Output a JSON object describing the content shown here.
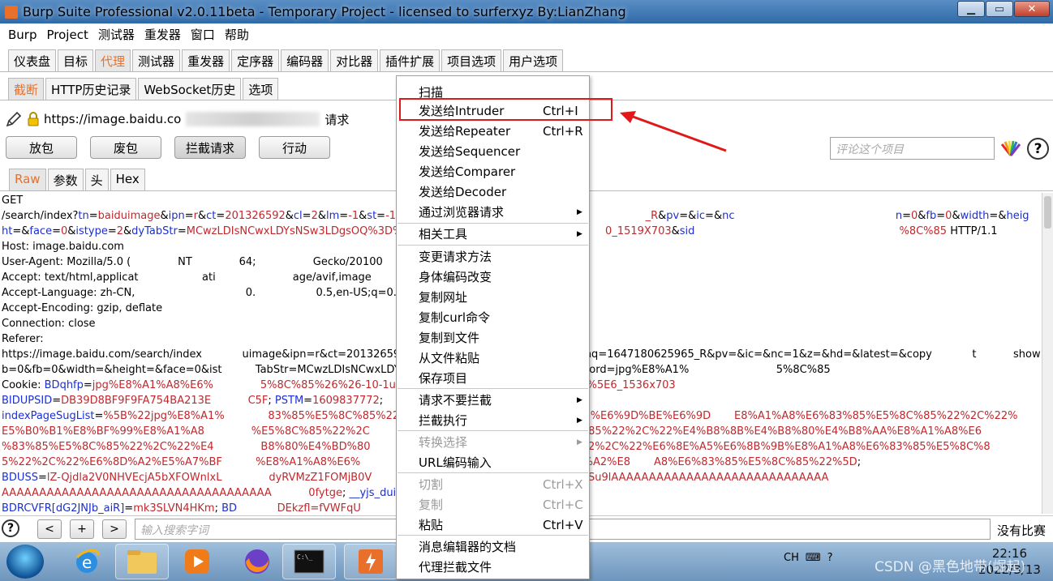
{
  "window": {
    "title": "Burp Suite Professional v2.0.11beta - Temporary Project - licensed to surferxyz By:LianZhang",
    "buttons": [
      "▁",
      "▭",
      "✕"
    ]
  },
  "menubar": [
    "Burp",
    "Project",
    "测试器",
    "重发器",
    "窗口",
    "帮助"
  ],
  "main_tabs": [
    "仪表盘",
    "目标",
    "代理",
    "测试器",
    "重发器",
    "定序器",
    "编码器",
    "对比器",
    "插件扩展",
    "项目选项",
    "用户选项"
  ],
  "main_tabs_active": "代理",
  "sub_tabs": [
    "截断",
    "HTTP历史记录",
    "WebSocket历史",
    "选项"
  ],
  "sub_tabs_active": "截断",
  "request": {
    "url_prefix": "https://image.baidu.co",
    "url_suffix": "请求"
  },
  "action_buttons": [
    "放包",
    "废包",
    "拦截请求",
    "行动"
  ],
  "comment_placeholder": "评论这个项目",
  "view_tabs": [
    "Raw",
    "参数",
    "头",
    "Hex"
  ],
  "view_tabs_active": "Raw",
  "editor_lines": [
    [
      {
        "t": "GET",
        "c": ""
      }
    ],
    [
      {
        "t": "/search/index?",
        "c": ""
      },
      {
        "t": "tn",
        "c": "blue"
      },
      {
        "t": "=",
        "c": ""
      },
      {
        "t": "baiduimage",
        "c": "red"
      },
      {
        "t": "&",
        "c": ""
      },
      {
        "t": "ipn",
        "c": "blue"
      },
      {
        "t": "=",
        "c": ""
      },
      {
        "t": "r",
        "c": "red"
      },
      {
        "t": "&",
        "c": ""
      },
      {
        "t": "ct",
        "c": "blue"
      },
      {
        "t": "=",
        "c": ""
      },
      {
        "t": "201326592",
        "c": "red"
      },
      {
        "t": "&",
        "c": ""
      },
      {
        "t": "cl",
        "c": "blue"
      },
      {
        "t": "=",
        "c": ""
      },
      {
        "t": "2",
        "c": "red"
      },
      {
        "t": "&",
        "c": ""
      },
      {
        "t": "lm",
        "c": "blue"
      },
      {
        "t": "=",
        "c": ""
      },
      {
        "t": "-1",
        "c": "red"
      },
      {
        "t": "&",
        "c": ""
      },
      {
        "t": "st",
        "c": "blue"
      },
      {
        "t": "=",
        "c": ""
      },
      {
        "t": "-1",
        "c": "red"
      },
      {
        "t": "&",
        "c": ""
      },
      {
        "t": "fm",
        "c": "blue"
      },
      {
        "t": "=re",
        "c": "red"
      },
      {
        "t": "                                                              ",
        "c": ""
      },
      {
        "t": "_R",
        "c": "red"
      },
      {
        "t": "&",
        "c": ""
      },
      {
        "t": "pv",
        "c": "blue"
      },
      {
        "t": "=&",
        "c": ""
      },
      {
        "t": "ic",
        "c": "blue"
      },
      {
        "t": "=&",
        "c": ""
      },
      {
        "t": "nc",
        "c": "blue"
      },
      {
        "t": "                                                ",
        "c": ""
      },
      {
        "t": "n",
        "c": "blue"
      },
      {
        "t": "=",
        "c": ""
      },
      {
        "t": "0",
        "c": "red"
      },
      {
        "t": "&",
        "c": ""
      },
      {
        "t": "fb",
        "c": "blue"
      },
      {
        "t": "=",
        "c": ""
      },
      {
        "t": "0",
        "c": "red"
      },
      {
        "t": "&",
        "c": ""
      },
      {
        "t": "width",
        "c": "blue"
      },
      {
        "t": "=&",
        "c": ""
      },
      {
        "t": "heig",
        "c": "blue"
      }
    ],
    [
      {
        "t": "ht",
        "c": "blue"
      },
      {
        "t": "=&",
        "c": ""
      },
      {
        "t": "face",
        "c": "blue"
      },
      {
        "t": "=",
        "c": ""
      },
      {
        "t": "0",
        "c": "red"
      },
      {
        "t": "&",
        "c": ""
      },
      {
        "t": "istype",
        "c": "blue"
      },
      {
        "t": "=",
        "c": ""
      },
      {
        "t": "2",
        "c": "red"
      },
      {
        "t": "&",
        "c": ""
      },
      {
        "t": "dyTabStr",
        "c": "blue"
      },
      {
        "t": "=",
        "c": ""
      },
      {
        "t": "MCwzLDIsNCwxLDYsNSw3LDgsOQ%3D%3D",
        "c": "red"
      },
      {
        "t": "                                                        ",
        "c": ""
      },
      {
        "t": "0_1519X703",
        "c": "red"
      },
      {
        "t": "&",
        "c": ""
      },
      {
        "t": "sid",
        "c": "blue"
      },
      {
        "t": "                                                             ",
        "c": ""
      },
      {
        "t": "%8C%85",
        "c": "red"
      },
      {
        "t": " HTTP/1.1",
        "c": ""
      }
    ],
    [
      {
        "t": "Host: image.baidu.com",
        "c": ""
      }
    ],
    [
      {
        "t": "User-Agent: Mozilla/5.0 (              NT              64;                 Gecko/20100",
        "c": ""
      }
    ],
    [
      {
        "t": "Accept: text/html,applicat                   ati                       age/avif,image",
        "c": ""
      }
    ],
    [
      {
        "t": "Accept-Language: zh-CN,                                 0.                  0.5,en-US;q=0.3,en",
        "c": ""
      }
    ],
    [
      {
        "t": "Accept-Encoding: gzip, deflate",
        "c": ""
      }
    ],
    [
      {
        "t": "Connection: close",
        "c": ""
      }
    ],
    [
      {
        "t": "Referer:",
        "c": ""
      }
    ],
    [
      {
        "t": "https://image.baidu.com/search/index            uimage&ipn=r&ct=201326592&                                              &fmq=1647180625965_R&pv=&ic=&nc=1&z=&hd=&latest=&copy            t           showta",
        "c": ""
      }
    ],
    [
      {
        "t": "b=0&fb=0&width=&height=&face=0&ist          TabStr=MCwzLDIsNCwxLDYs                                               =&word=jpg%E8%A1%                          5%8C%85",
        "c": ""
      }
    ],
    [
      {
        "t": "Cookie: ",
        "c": ""
      },
      {
        "t": "BDqhfp",
        "c": "blue"
      },
      {
        "t": "=",
        "c": ""
      },
      {
        "t": "jpg%E8%A1%A8%E6%              5%8C%85%26%26-10-1u",
        "c": "red"
      },
      {
        "t": "                                                    ",
        "c": ""
      },
      {
        "t": "H",
        "c": "blue"
      },
      {
        "t": "=",
        "c": ""
      },
      {
        "t": "%5E6_1536x703",
        "c": "red"
      }
    ],
    [
      {
        "t": "BIDUPSID",
        "c": "blue"
      },
      {
        "t": "=",
        "c": ""
      },
      {
        "t": "DB39D8BF9F9FA754BA213E           C5F",
        "c": "red"
      },
      {
        "t": "; ",
        "c": ""
      },
      {
        "t": "PSTM",
        "c": "blue"
      },
      {
        "t": "=",
        "c": ""
      },
      {
        "t": "1609837772",
        "c": "red"
      },
      {
        "t": ";",
        "c": ""
      }
    ],
    [
      {
        "t": "indexPageSugList",
        "c": "blue"
      },
      {
        "t": "=",
        "c": ""
      },
      {
        "t": "%5B%22jpg%E8%A1%             83%85%E5%8C%85%22%",
        "c": "red"
      },
      {
        "t": "                                                      ",
        "c": ""
      },
      {
        "t": "%E6%9D%BE%E6%9D       E8%A1%A8%E6%83%85%E5%8C%85%22%2C%22%",
        "c": "red"
      }
    ],
    [
      {
        "t": "E5%B0%B1%E8%BF%99%E8%A1%A8              %E5%8C%85%22%2C",
        "c": "red"
      },
      {
        "t": "                                                     ",
        "c": ""
      },
      {
        "t": "5%8C%85%22%2C%22%E4%B8%8B%E4%B8%80%E4%B8%AA%E8%A1%A8%E6",
        "c": "red"
      }
    ],
    [
      {
        "t": "%83%85%E5%8C%85%22%2C%22%E4              B8%80%E4%BD%80",
        "c": "red"
      },
      {
        "t": "                                                     ",
        "c": ""
      },
      {
        "t": "%85%22%2C%22%E6%8E%A5%E6%8B%9B%E8%A1%A8%E6%83%85%E5%8C%8",
        "c": "red"
      }
    ],
    [
      {
        "t": "5%22%2C%22%E6%8D%A2%E5%A7%BF          %E8%A1%A8%E6%",
        "c": "red"
      },
      {
        "t": "                                                      ",
        "c": ""
      },
      {
        "t": "%6%8D%A2%E8       A8%E6%83%85%E5%8C%85%22%5D",
        "c": "red"
      },
      {
        "t": ";",
        "c": ""
      }
    ],
    [
      {
        "t": "BDUSS",
        "c": "blue"
      },
      {
        "t": "=",
        "c": ""
      },
      {
        "t": "lZ-Qjdla2V0NHVEcjA5bXFOWnlxL",
        "c": "red"
      },
      {
        "t": "              ",
        "c": ""
      },
      {
        "t": "dyRVMzZ1FOMjB0V",
        "c": "red"
      },
      {
        "t": "                                                       ",
        "c": ""
      },
      {
        "t": "bkx7vSu9lAAAAAAAAAAAAAAAAAAAAAAAAAAAAA",
        "c": "red"
      }
    ],
    [
      {
        "t": "AAAAAAAAAAAAAAAAAAAAAAAAAAAAAAAAAAAA",
        "c": "red"
      },
      {
        "t": "           ",
        "c": ""
      },
      {
        "t": "0fytge",
        "c": "red"
      },
      {
        "t": "; ",
        "c": ""
      },
      {
        "t": "__yjs_dui",
        "c": "blue"
      }
    ],
    [
      {
        "t": "BDRCVFR[dG2JNJb_aiR]",
        "c": "blue"
      },
      {
        "t": "=",
        "c": ""
      },
      {
        "t": "mk3SLVN4HKm",
        "c": "red"
      },
      {
        "t": "; ",
        "c": ""
      },
      {
        "t": "BD",
        "c": "blue"
      },
      {
        "t": "            ",
        "c": ""
      },
      {
        "t": "DEkzfl=fVWFqU",
        "c": "red"
      }
    ]
  ],
  "searchbar": {
    "help": "?",
    "nav_buttons": [
      "<",
      "+",
      ">"
    ],
    "placeholder": "输入搜索字词",
    "matches": "没有比赛"
  },
  "context_menu": {
    "items": [
      {
        "label": "扫描",
        "shortcut": "",
        "arrow": false,
        "disabled": false
      },
      {
        "label": "发送给Intruder",
        "shortcut": "Ctrl+I",
        "arrow": false,
        "disabled": false
      },
      {
        "label": "发送给Repeater",
        "shortcut": "Ctrl+R",
        "arrow": false,
        "disabled": false
      },
      {
        "label": "发送给Sequencer",
        "shortcut": "",
        "arrow": false,
        "disabled": false
      },
      {
        "label": "发送给Comparer",
        "shortcut": "",
        "arrow": false,
        "disabled": false
      },
      {
        "label": "发送给Decoder",
        "shortcut": "",
        "arrow": false,
        "disabled": false
      },
      {
        "label": "通过浏览器请求",
        "shortcut": "",
        "arrow": true,
        "disabled": false
      },
      {
        "label": "相关工具",
        "shortcut": "",
        "arrow": true,
        "disabled": false
      },
      {
        "label": "变更请求方法",
        "shortcut": "",
        "arrow": false,
        "disabled": false
      },
      {
        "label": "身体编码改变",
        "shortcut": "",
        "arrow": false,
        "disabled": false
      },
      {
        "label": "复制网址",
        "shortcut": "",
        "arrow": false,
        "disabled": false
      },
      {
        "label": "复制curl命令",
        "shortcut": "",
        "arrow": false,
        "disabled": false
      },
      {
        "label": "复制到文件",
        "shortcut": "",
        "arrow": false,
        "disabled": false
      },
      {
        "label": "从文件粘贴",
        "shortcut": "",
        "arrow": false,
        "disabled": false
      },
      {
        "label": "保存项目",
        "shortcut": "",
        "arrow": false,
        "disabled": false
      },
      {
        "label": "请求不要拦截",
        "shortcut": "",
        "arrow": true,
        "disabled": false
      },
      {
        "label": "拦截执行",
        "shortcut": "",
        "arrow": true,
        "disabled": false
      },
      {
        "label": "转换选择",
        "shortcut": "",
        "arrow": true,
        "disabled": true
      },
      {
        "label": "URL编码输入",
        "shortcut": "",
        "arrow": false,
        "disabled": false
      },
      {
        "label": "切割",
        "shortcut": "Ctrl+X",
        "arrow": false,
        "disabled": true
      },
      {
        "label": "复制",
        "shortcut": "Ctrl+C",
        "arrow": false,
        "disabled": true
      },
      {
        "label": "粘贴",
        "shortcut": "Ctrl+V",
        "arrow": false,
        "disabled": false
      },
      {
        "label": "消息编辑器的文档",
        "shortcut": "",
        "arrow": false,
        "disabled": false
      },
      {
        "label": "代理拦截文件",
        "shortcut": "",
        "arrow": false,
        "disabled": false
      }
    ],
    "highlighted": "发送给Intruder",
    "highlight_color": "#e01818"
  },
  "taskbar": {
    "tray_lang": "CH",
    "clock_time": "22:16",
    "clock_date": "2022/3/13",
    "watermark": "CSDN @黑色地带(崛起)"
  }
}
